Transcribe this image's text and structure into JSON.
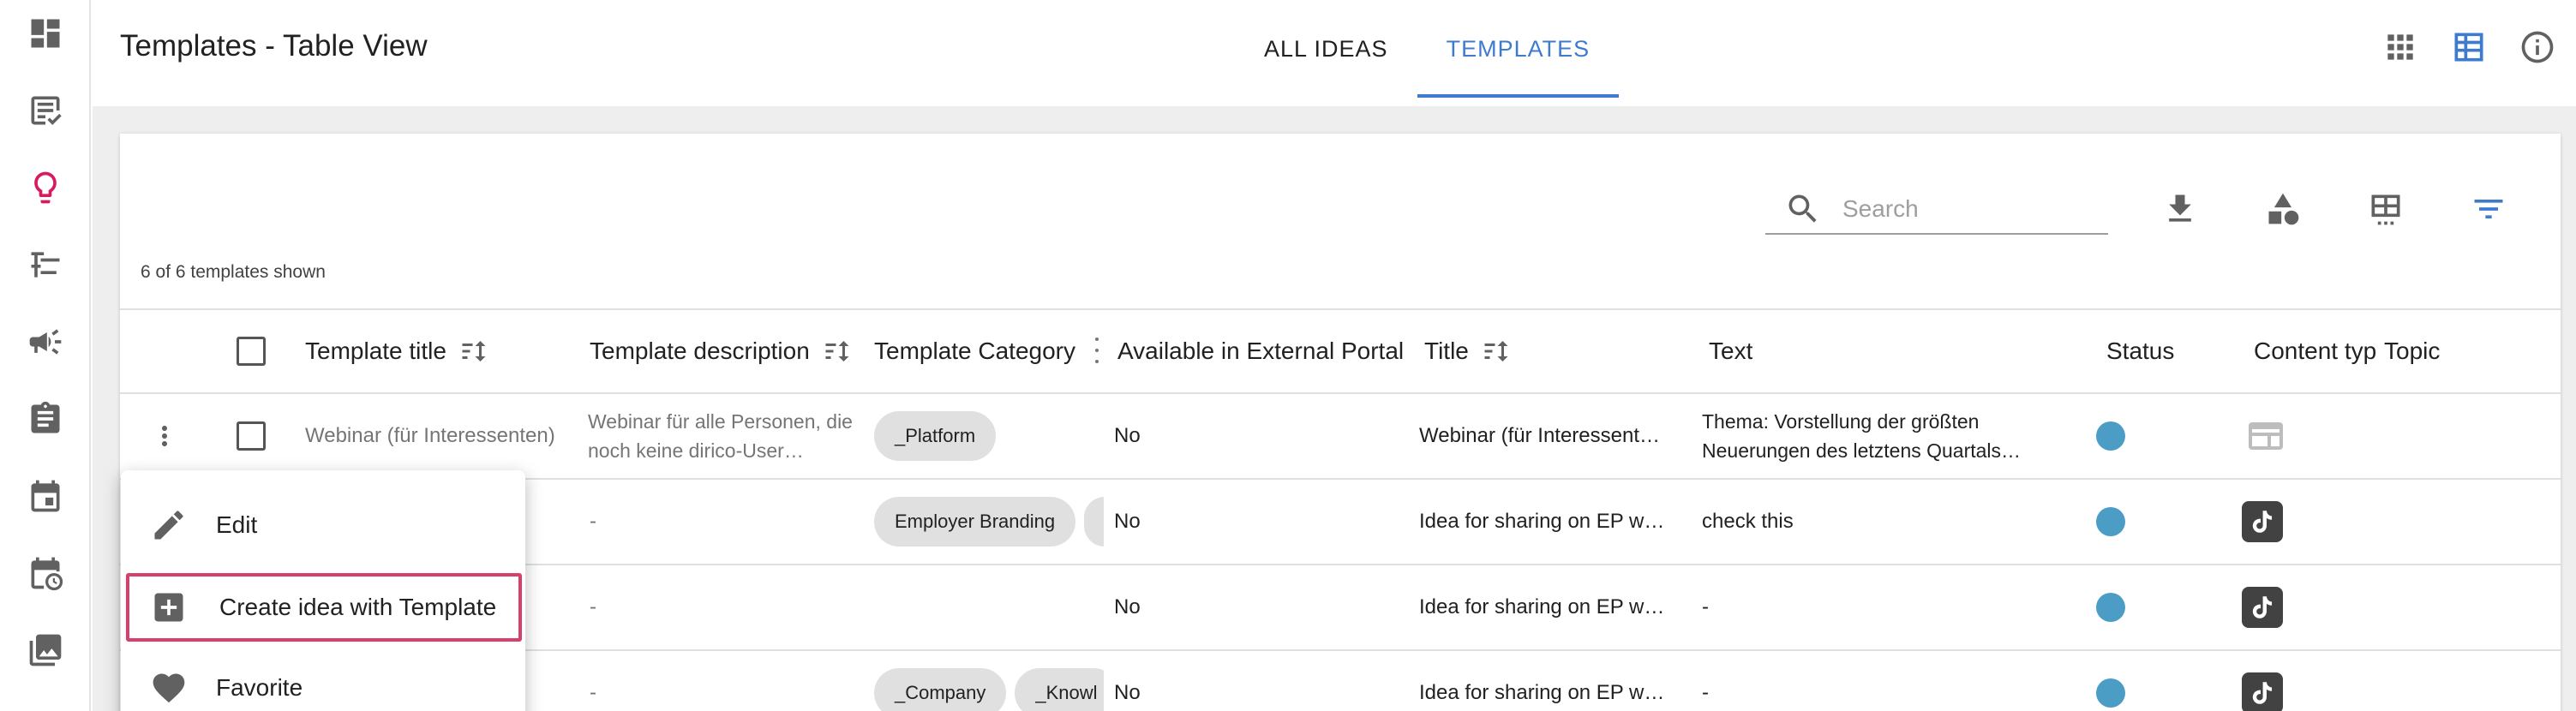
{
  "rail": {
    "items": [
      {
        "icon": "dashboard-icon",
        "active": false
      },
      {
        "icon": "ideas-list-icon",
        "active": false
      },
      {
        "icon": "lightbulb-icon",
        "active": true
      },
      {
        "icon": "timeline-icon",
        "active": false
      },
      {
        "icon": "campaign-icon",
        "active": false
      },
      {
        "icon": "clipboard-icon",
        "active": false
      },
      {
        "icon": "calendar-icon",
        "active": false
      },
      {
        "icon": "scheduled-calendar-icon",
        "active": false
      },
      {
        "icon": "media-library-icon",
        "active": false
      }
    ]
  },
  "header": {
    "title": "Templates - Table View",
    "tabs": [
      {
        "label": "ALL IDEAS",
        "active": false
      },
      {
        "label": "TEMPLATES",
        "active": true
      }
    ],
    "actions": [
      "grid-view-icon",
      "table-view-icon",
      "info-icon"
    ]
  },
  "toolbar": {
    "search_placeholder": "Search",
    "shown_count": "6 of 6 templates shown",
    "tools": [
      "download-icon",
      "shapes-icon",
      "table-columns-icon",
      "filter-icon"
    ]
  },
  "table": {
    "columns": [
      {
        "label": "Template title",
        "sortable": true
      },
      {
        "label": "Template description",
        "sortable": true
      },
      {
        "label": "Template Category",
        "sortable": false
      },
      {
        "label": "Available in External Portal",
        "sortable": false
      },
      {
        "label": "Title",
        "sortable": true
      },
      {
        "label": "Text",
        "sortable": false
      },
      {
        "label": "Status",
        "sortable": false
      },
      {
        "label": "Content typ",
        "sortable": false
      },
      {
        "label": "Topic",
        "sortable": false
      }
    ],
    "rows": [
      {
        "template_title": "Webinar (für Interessenten)",
        "template_description": "Webinar für alle Personen, die noch keine dirico-User…",
        "categories": [
          "_Platform"
        ],
        "external_portal": "No",
        "title": "Webinar (für Interessent…",
        "text": "Thema: Vorstellung der größten Neuerungen des letztens Quartals…",
        "status_color": "#4b9dc6",
        "content_type": "web-page-icon"
      },
      {
        "template_title": "",
        "template_description": "-",
        "categories": [
          "Employer Branding",
          ""
        ],
        "external_portal": "No",
        "title": "Idea for sharing on EP w…",
        "text": "check this",
        "status_color": "#4b9dc6",
        "content_type": "tiktok-icon"
      },
      {
        "template_title": "",
        "template_description": "-",
        "categories": [],
        "external_portal": "No",
        "title": "Idea for sharing on EP w…",
        "text": "-",
        "status_color": "#4b9dc6",
        "content_type": "tiktok-icon"
      },
      {
        "template_title": "",
        "template_description": "-",
        "categories": [
          "_Company",
          "_Knowl"
        ],
        "external_portal": "No",
        "title": "Idea for sharing on EP w…",
        "text": "-",
        "status_color": "#4b9dc6",
        "content_type": "tiktok-icon"
      }
    ]
  },
  "context_menu": {
    "items": [
      {
        "label": "Edit",
        "icon": "pencil-icon"
      },
      {
        "label": "Create idea with Template",
        "icon": "add-box-icon",
        "highlighted": true
      },
      {
        "label": "Favorite",
        "icon": "heart-icon"
      }
    ]
  }
}
